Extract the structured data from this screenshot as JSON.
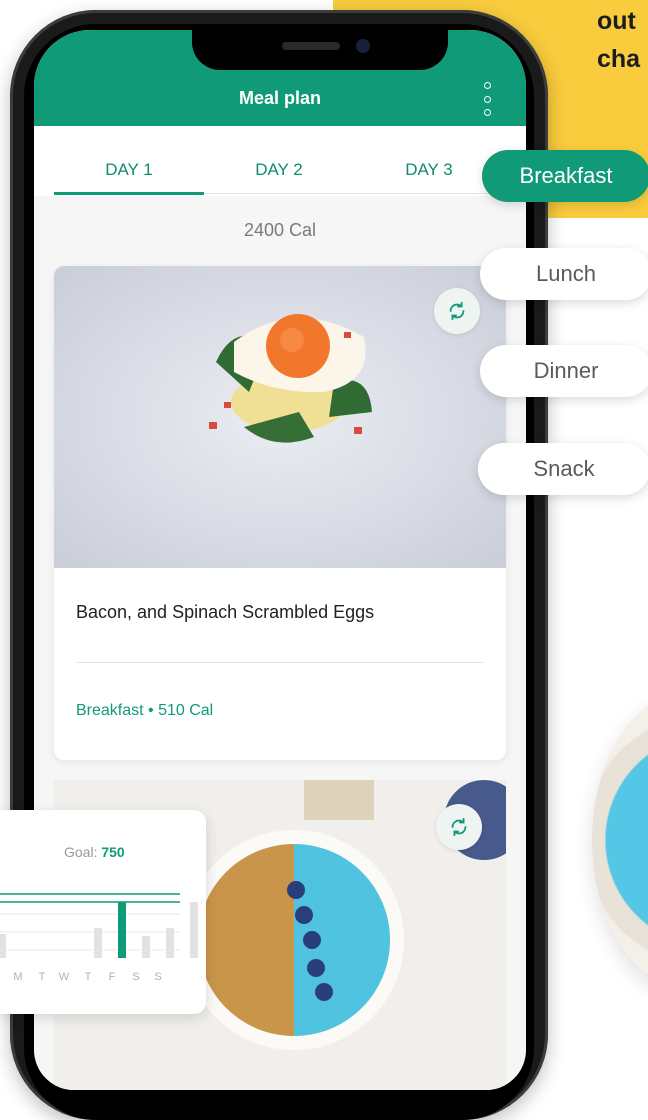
{
  "promo": {
    "line1": "out",
    "line2": "cha"
  },
  "app": {
    "title": "Meal plan",
    "menu_icon": "more-vertical-icon"
  },
  "tabs": [
    {
      "label": "DAY 1",
      "active": true
    },
    {
      "label": "DAY 2",
      "active": false
    },
    {
      "label": "DAY 3",
      "active": false
    }
  ],
  "daily_calories": "2400 Cal",
  "meals": [
    {
      "title": "Bacon, and Spinach Scrambled Eggs",
      "meta": "Breakfast • 510 Cal",
      "swap_icon": "refresh-icon"
    },
    {
      "swap_icon": "refresh-icon"
    }
  ],
  "meal_types": [
    {
      "label": "Breakfast",
      "active": true
    },
    {
      "label": "Lunch",
      "active": false
    },
    {
      "label": "Dinner",
      "active": false
    },
    {
      "label": "Snack",
      "active": false
    }
  ],
  "goal_widget": {
    "label": "Goal: ",
    "value": "750",
    "chart_data": {
      "type": "bar",
      "categories": [
        "M",
        "T",
        "W",
        "T",
        "F",
        "S",
        "S"
      ],
      "highlighted": [
        false,
        false,
        true,
        false,
        false,
        false,
        true
      ]
    }
  },
  "colors": {
    "accent": "#119a78",
    "promo_yellow": "#F9CC3D"
  }
}
